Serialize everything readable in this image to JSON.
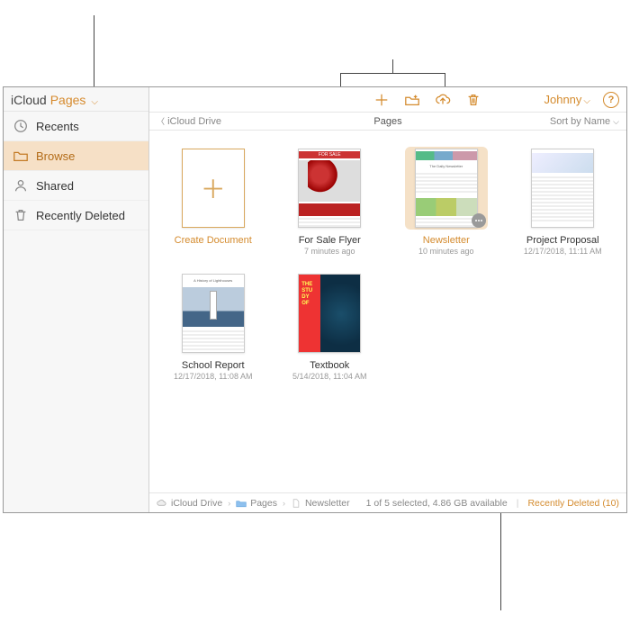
{
  "sidebar": {
    "title_prefix": "iCloud",
    "title_app": "Pages",
    "items": [
      {
        "id": "recents",
        "label": "Recents",
        "icon": "clock-icon"
      },
      {
        "id": "browse",
        "label": "Browse",
        "icon": "folder-icon",
        "selected": true
      },
      {
        "id": "shared",
        "label": "Shared",
        "icon": "shared-icon"
      },
      {
        "id": "recently_deleted",
        "label": "Recently Deleted",
        "icon": "trash-icon"
      }
    ]
  },
  "toolbar": {
    "user_name": "Johnny"
  },
  "location": {
    "back_label": "iCloud Drive",
    "title": "Pages",
    "sort_label": "Sort by Name"
  },
  "documents": [
    {
      "title": "Create Document",
      "subtitle": "",
      "create": true
    },
    {
      "title": "For Sale Flyer",
      "subtitle": "7 minutes ago"
    },
    {
      "title": "Newsletter",
      "subtitle": "10 minutes ago",
      "selected": true
    },
    {
      "title": "Project Proposal",
      "subtitle": "12/17/2018, 11:11 AM"
    },
    {
      "title": "School Report",
      "subtitle": "12/17/2018, 11:08 AM"
    },
    {
      "title": "Textbook",
      "subtitle": "5/14/2018, 11:04 AM"
    }
  ],
  "status": {
    "crumbs": [
      "iCloud Drive",
      "Pages",
      "Newsletter"
    ],
    "selection": "1 of 5 selected, 4.86 GB available",
    "recently_deleted_link": "Recently Deleted (10)"
  },
  "colors": {
    "accent": "#d48b2e"
  }
}
